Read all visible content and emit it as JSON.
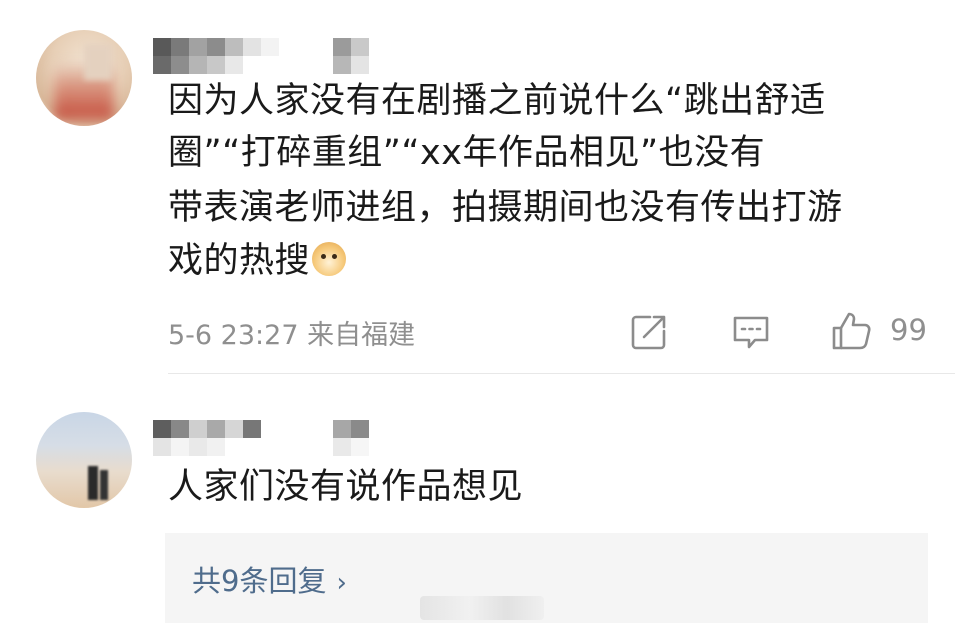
{
  "comments": [
    {
      "lines": [
        "因为人家没有在剧播之前说什么“跳出舒适",
        "圈”“打碎重组”“xx年作品相见”也没有",
        "带表演老师进组，拍摄期间也没有传出打游",
        "戏的热搜"
      ],
      "emoji": "doge-emoji",
      "meta": "5-6 23:27 来自福建",
      "like_count": "99"
    },
    {
      "lines": [
        "人家们没有说作品想见"
      ],
      "replies_label": "共9条回复",
      "replies_chevron": "›"
    }
  ],
  "colors": {
    "text": "#1a1a1a",
    "meta": "#8f8f8f",
    "link": "#4f6c8c",
    "reply_bg": "#f5f5f5"
  },
  "icons": [
    "share-icon",
    "comment-icon",
    "like-icon",
    "chevron-right-icon"
  ]
}
